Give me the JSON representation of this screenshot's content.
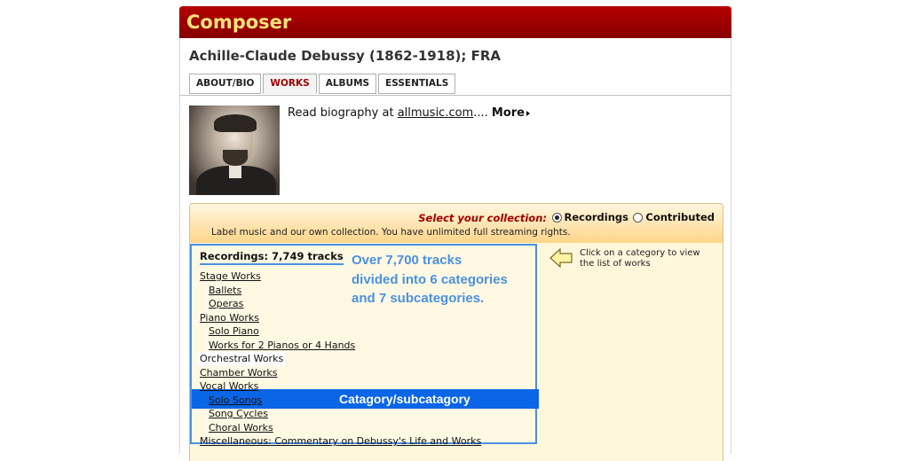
{
  "header": {
    "title": "Composer"
  },
  "composer": {
    "name": "Achille-Claude Debussy (1862-1918); FRA"
  },
  "tabs": [
    {
      "label": "ABOUT/BIO"
    },
    {
      "label": "WORKS"
    },
    {
      "label": "ALBUMS"
    },
    {
      "label": "ESSENTIALS"
    }
  ],
  "bio": {
    "prefix": "Read biography at ",
    "link": "allmusic.com",
    "suffix": "....",
    "more": "More"
  },
  "collection": {
    "label": "Select your collection:",
    "options": [
      "Recordings",
      "Contributed"
    ],
    "selected": "Recordings",
    "info": "Label music and our own collection. You have unlimited full streaming rights."
  },
  "recordings": {
    "heading": "Recordings: 7,749 tracks"
  },
  "categories": [
    {
      "label": "Stage Works",
      "level": 0
    },
    {
      "label": "Ballets",
      "level": 1
    },
    {
      "label": "Operas",
      "level": 1
    },
    {
      "label": "Piano Works",
      "level": 0
    },
    {
      "label": "Solo Piano",
      "level": 1
    },
    {
      "label": "Works for 2 Pianos or 4 Hands",
      "level": 1
    },
    {
      "label": "Orchestral Works",
      "level": 0
    },
    {
      "label": "Chamber Works",
      "level": 0
    },
    {
      "label": "Vocal Works",
      "level": 0
    },
    {
      "label": "Solo Songs",
      "level": 1
    },
    {
      "label": "Song Cycles",
      "level": 1
    },
    {
      "label": "Choral Works",
      "level": 1
    },
    {
      "label": "Miscellaneous: Commentary on Debussy's Life and Works",
      "level": 0
    }
  ],
  "annotations": {
    "callout_line1": "Over 7,700 tracks",
    "callout_line2": "divided into 6 categories",
    "callout_line3": "and 7 subcategories.",
    "category_label": "Catagory/subcatagory"
  },
  "hint": {
    "text": "Click on a category to view the list of works"
  },
  "colors": {
    "header_red": "#a00000",
    "header_text": "#ffe27a",
    "annotation_blue": "#4a90e2",
    "highlight_blue": "#0a66e6"
  }
}
